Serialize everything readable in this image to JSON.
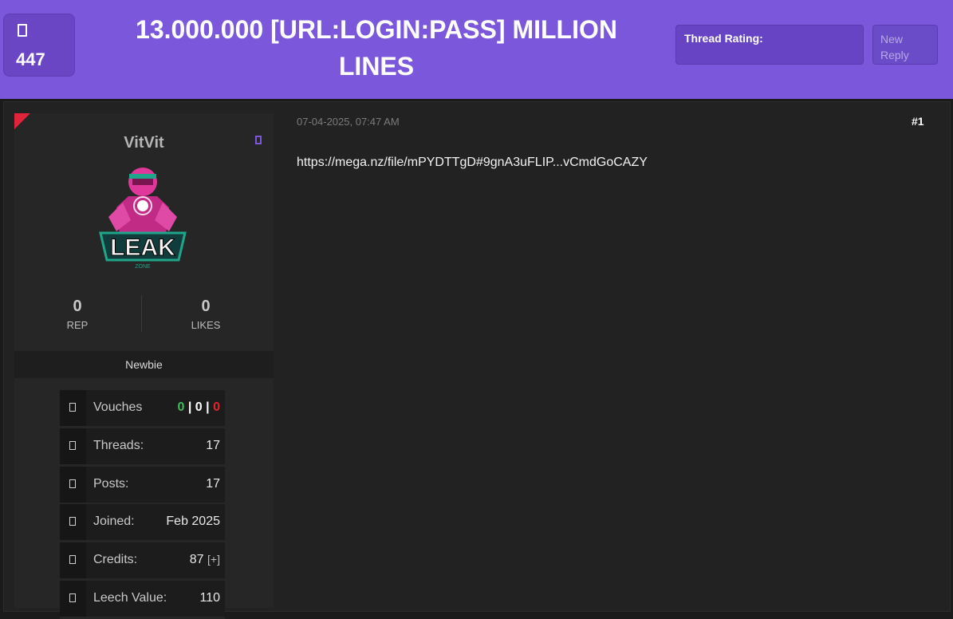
{
  "header": {
    "views_icon": "eye-icon",
    "views_count": "447",
    "title": "13.000.000 [URL:LOGIN:PASS] MILLION LINES",
    "rating_label": "Thread Rating:",
    "new_reply_label": "New Reply"
  },
  "post": {
    "date": "07-04-2025, 07:47 AM",
    "number": "#1",
    "link_text": "https://mega.nz/file/mPYDTTgD#9gnA3uFLIP...vCmdGoCAZY"
  },
  "user": {
    "name": "VitVit",
    "gender_icon": "user-gender-icon",
    "avatar_text": "LEAK",
    "avatar_sub": "ZONE",
    "rep_value": "0",
    "rep_label": "REP",
    "likes_value": "0",
    "likes_label": "LIKES",
    "rank": "Newbie",
    "vouches": {
      "label": "Vouches",
      "positive": "0",
      "neutral": "0",
      "negative": "0",
      "sep": "|"
    },
    "threads": {
      "label": "Threads:",
      "value": "17"
    },
    "posts": {
      "label": "Posts:",
      "value": "17"
    },
    "joined": {
      "label": "Joined:",
      "value": "Feb 2025"
    },
    "credits": {
      "label": "Credits:",
      "value": "87",
      "add": "[+]"
    },
    "leech": {
      "label": "Leech Value:",
      "value": "110"
    }
  },
  "colors": {
    "header_bg": "#7b57dc",
    "flag": "#e0243c",
    "vouch_positive": "#3dbd5a",
    "vouch_negative": "#e4212b"
  }
}
